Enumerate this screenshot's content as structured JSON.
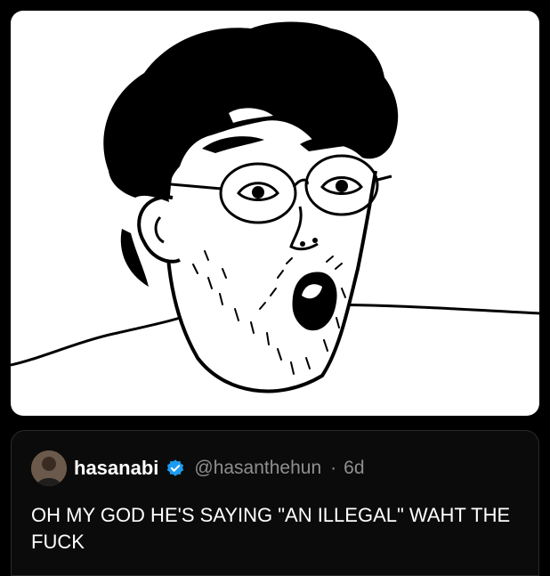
{
  "meme": {
    "icon": "meme-face-icon"
  },
  "tweet": {
    "display_name": "hasanabi",
    "handle": "@hasanthehun",
    "separator": "·",
    "time": "6d",
    "text": "OH MY GOD HE'S SAYING \"AN ILLEGAL\" WAHT THE FUCK",
    "verified_color": "#1d9bf0",
    "avatar": "avatar-icon"
  }
}
